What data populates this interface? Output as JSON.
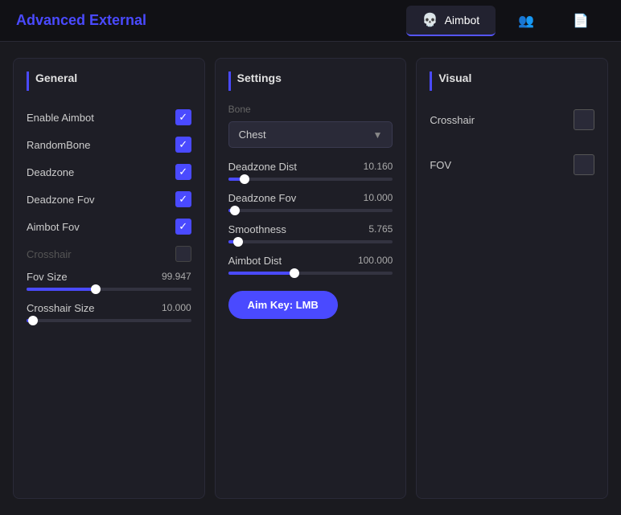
{
  "app": {
    "title": "Advanced External",
    "tabs": [
      {
        "id": "aimbot",
        "label": "Aimbot",
        "icon": "💀",
        "active": true
      },
      {
        "id": "players",
        "label": "",
        "icon": "👥",
        "active": false
      },
      {
        "id": "settings",
        "label": "",
        "icon": "📄",
        "active": false
      }
    ]
  },
  "general_panel": {
    "title": "General",
    "items": [
      {
        "label": "Enable Aimbot",
        "checked": true,
        "disabled": false
      },
      {
        "label": "RandomBone",
        "checked": true,
        "disabled": false
      },
      {
        "label": "Deadzone",
        "checked": true,
        "disabled": false
      },
      {
        "label": "Deadzone Fov",
        "checked": true,
        "disabled": false
      },
      {
        "label": "Aimbot Fov",
        "checked": true,
        "disabled": false
      },
      {
        "label": "Crosshair",
        "checked": false,
        "disabled": true
      }
    ],
    "fov_size": {
      "label": "Fov Size",
      "value": "99.947",
      "fill_percent": 42
    },
    "crosshair_size": {
      "label": "Crosshair Size",
      "value": "10.000",
      "fill_percent": 4
    }
  },
  "settings_panel": {
    "title": "Settings",
    "bone_label": "Bone",
    "bone_value": "Chest",
    "deadzone_dist": {
      "label": "Deadzone Dist",
      "value": "10.160",
      "fill_percent": 10
    },
    "deadzone_fov": {
      "label": "Deadzone Fov",
      "value": "10.000",
      "fill_percent": 4
    },
    "smoothness": {
      "label": "Smoothness",
      "value": "5.765",
      "fill_percent": 6
    },
    "aimbot_dist": {
      "label": "Aimbot Dist",
      "value": "100.000",
      "fill_percent": 40
    },
    "aim_key_label": "Aim Key: LMB"
  },
  "visual_panel": {
    "title": "Visual",
    "crosshair_label": "Crosshair",
    "fov_label": "FOV"
  }
}
